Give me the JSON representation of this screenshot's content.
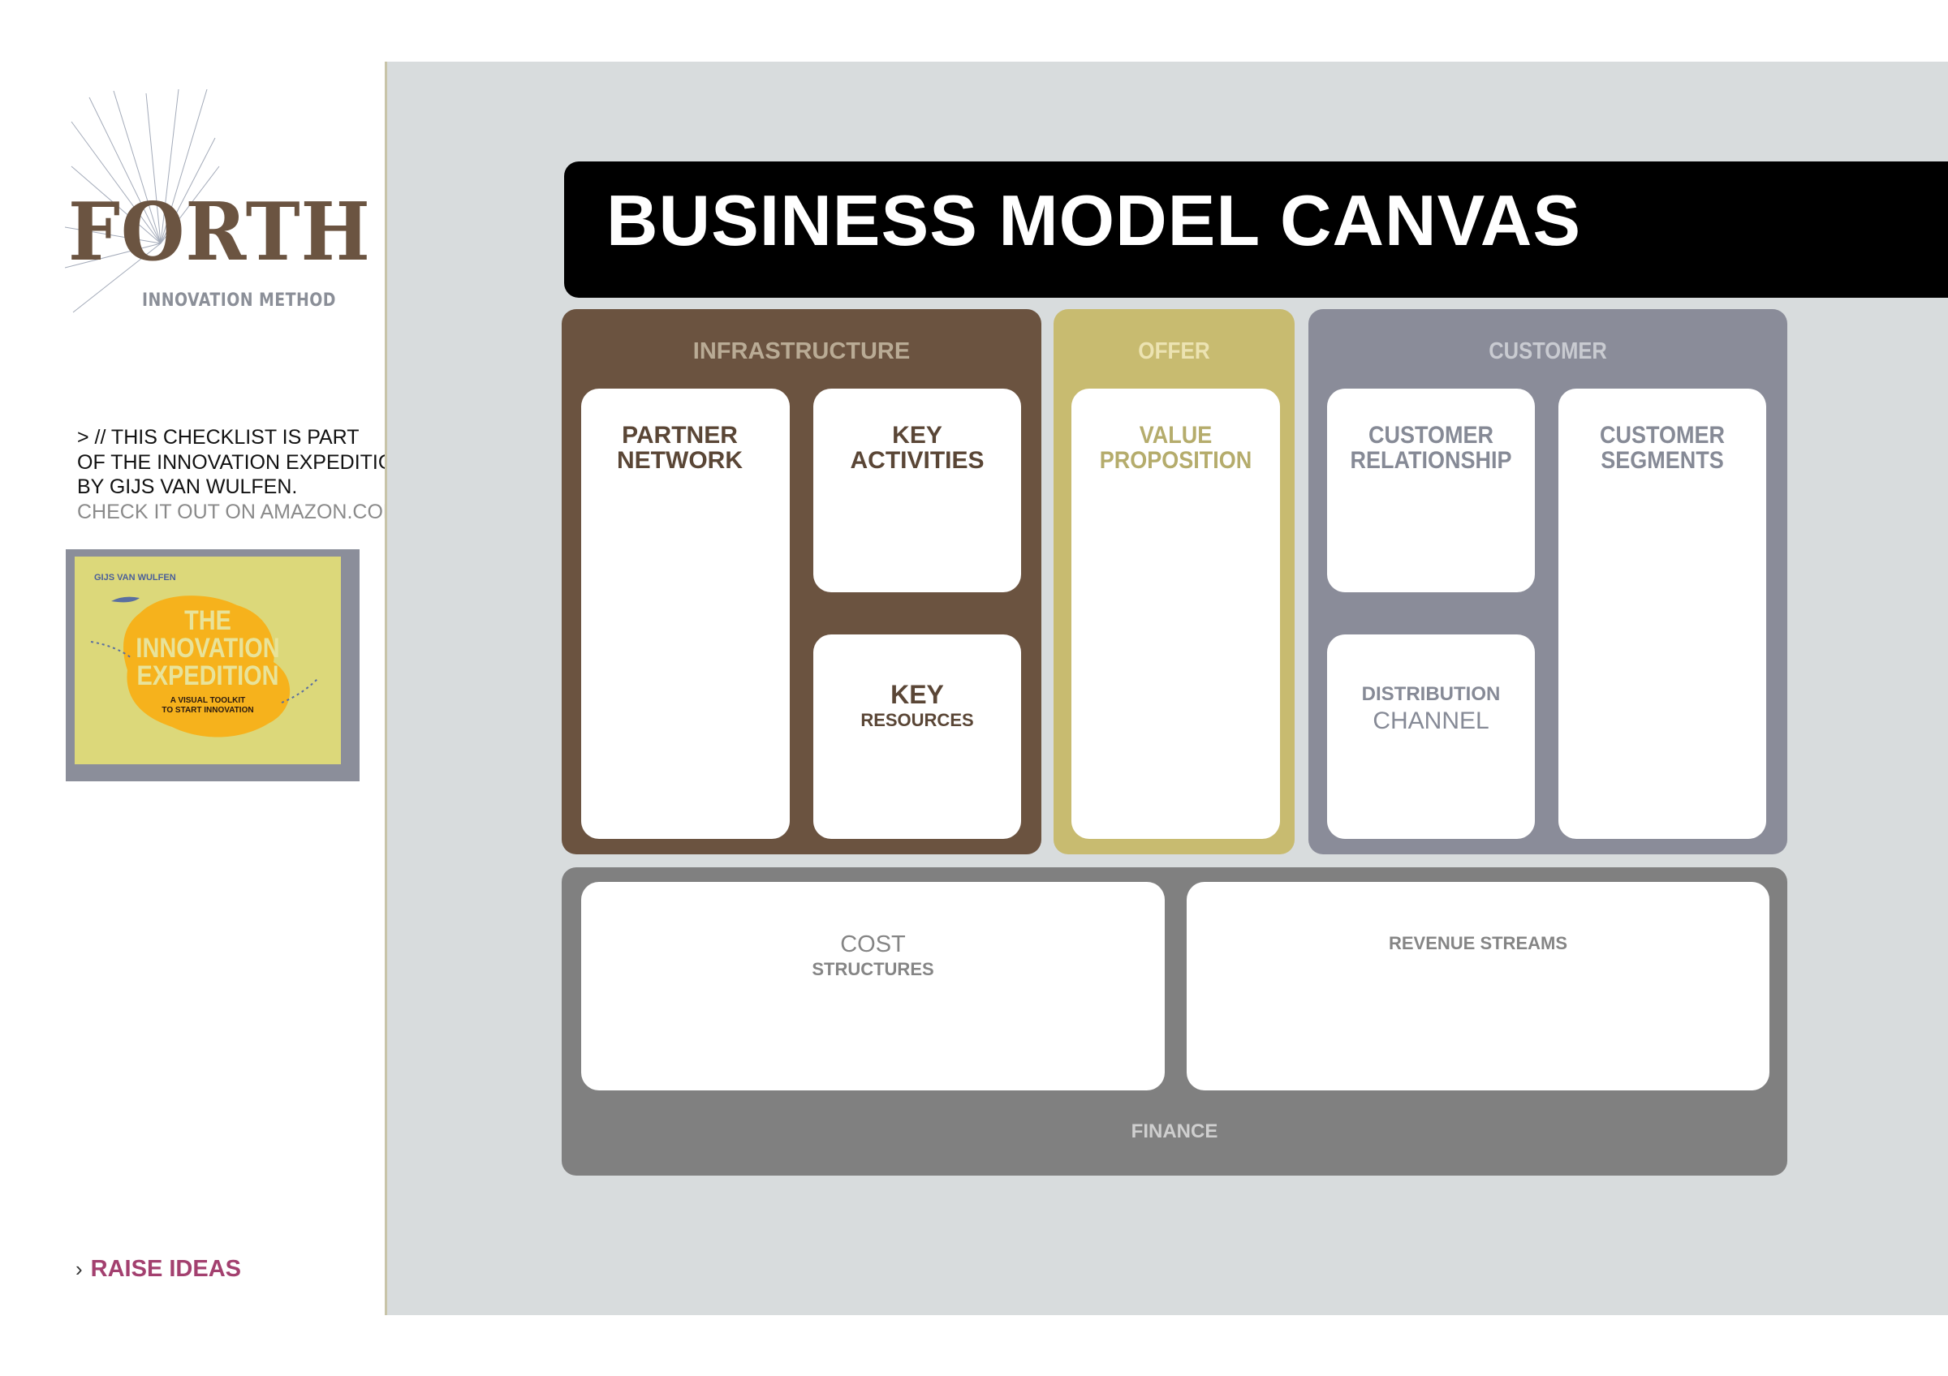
{
  "sidebar": {
    "logo": {
      "wordmark": "FORTH",
      "tagline": "INNOVATION METHOD"
    },
    "intro_lines": [
      "> // THIS CHECKLIST IS PART",
      "OF THE INNOVATION EXPEDITION,",
      "BY GIJS VAN WULFEN."
    ],
    "intro_link": "CHECK IT OUT ON AMAZON.COM",
    "book": {
      "author": "GIJS VAN WULFEN",
      "title_lines": [
        "THE",
        "INNOVATION",
        "EXPEDITION"
      ],
      "subtitle_lines": [
        "A VISUAL TOOLKIT",
        "TO START INNOVATION"
      ]
    },
    "step": {
      "chevron": "›",
      "label": "RAISE IDEAS"
    }
  },
  "canvas": {
    "title": "BUSINESS MODEL CANVAS",
    "colors": {
      "infrastructure": "#6b5340",
      "offer": "#c8bb70",
      "customer": "#8a8c99",
      "finance": "#808080",
      "background": "#d8dcdd"
    },
    "infrastructure": {
      "title": "INFRASTRUCTURE",
      "partner_network": [
        "PARTNER",
        "NETWORK"
      ],
      "key_activities": [
        "KEY",
        "ACTIVITIES"
      ],
      "key_resources": [
        "KEY",
        "RESOURCES"
      ]
    },
    "offer": {
      "title": "OFFER",
      "value_proposition": [
        "VALUE",
        "PROPOSITION"
      ]
    },
    "customer": {
      "title": "CUSTOMER",
      "customer_relationship": [
        "CUSTOMER",
        "RELATIONSHIP"
      ],
      "customer_segments": [
        "CUSTOMER",
        "SEGMENTS"
      ],
      "distribution_channel": [
        "DISTRIBUTION",
        "CHANNEL"
      ]
    },
    "finance": {
      "title": "FINANCE",
      "cost_structures": [
        "COST",
        "STRUCTURES"
      ],
      "revenue_streams": "REVENUE STREAMS"
    }
  }
}
